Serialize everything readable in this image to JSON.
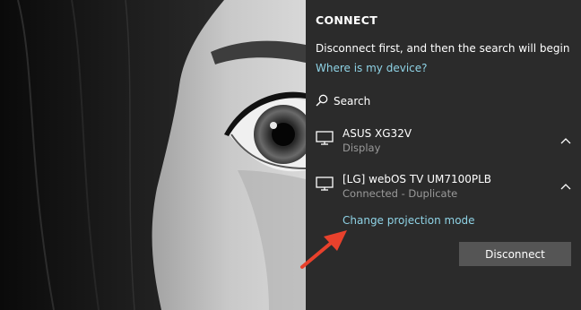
{
  "panel": {
    "title": "CONNECT",
    "description": "Disconnect first, and then the search will begin",
    "where_link": "Where is my device?",
    "search_label": "Search",
    "search_icon": "search-icon"
  },
  "devices": [
    {
      "name": "ASUS XG32V",
      "status": "Display",
      "icon": "monitor-icon"
    },
    {
      "name": "[LG] webOS TV UM7100PLB",
      "status": "Connected - Duplicate",
      "icon": "monitor-icon"
    }
  ],
  "actions": {
    "change_projection": "Change projection mode",
    "disconnect": "Disconnect"
  },
  "colors": {
    "panel_bg": "#2b2b2b",
    "link": "#8fd3e6",
    "button_bg": "#555555",
    "annotation_arrow": "#e8412c"
  }
}
